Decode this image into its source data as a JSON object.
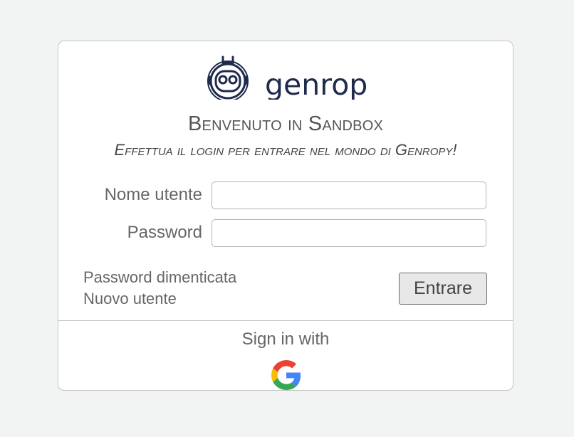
{
  "brand": {
    "name": "genropy",
    "color": "#1f2a4d"
  },
  "welcome": {
    "title": "Benvenuto in Sandbox",
    "subtitle": "Effettua il login per entrare nel mondo di Genropy!"
  },
  "form": {
    "username_label": "Nome utente",
    "username_value": "",
    "password_label": "Password",
    "password_value": ""
  },
  "links": {
    "forgot_password": "Password dimenticata",
    "new_user": "Nuovo utente"
  },
  "actions": {
    "submit_label": "Entrare"
  },
  "social": {
    "signin_label": "Sign in with",
    "providers": [
      {
        "icon": "google-icon",
        "colors": [
          "#4285F4",
          "#EA4335",
          "#FBBC05",
          "#34A853"
        ]
      }
    ]
  }
}
